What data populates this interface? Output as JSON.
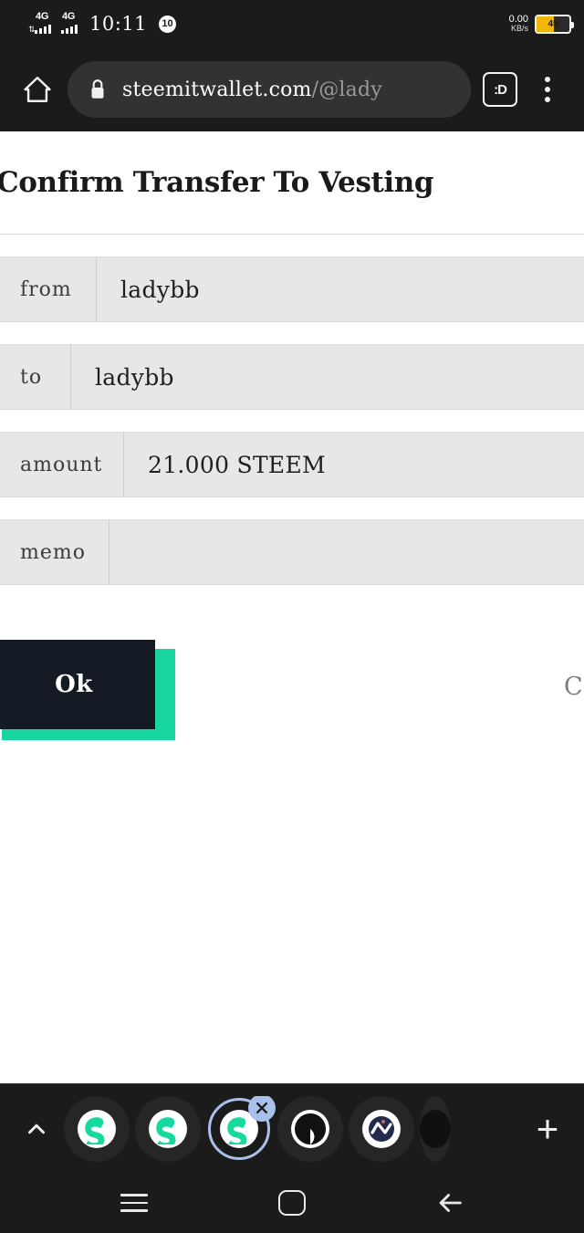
{
  "statusbar": {
    "network_1": "4G",
    "network_2": "4G",
    "time": "10:11",
    "notif_badge": "10",
    "net_speed_value": "0.00",
    "net_speed_unit": "KB/s",
    "battery_level": "45"
  },
  "browser": {
    "home_icon": "home-icon",
    "lock_icon": "lock-icon",
    "url_domain": "steemitwallet.com",
    "url_path": "/@lady",
    "url_full": "steemitwallet.com/@lady",
    "smiley_label": ":D",
    "menu_icon": "overflow-menu-icon"
  },
  "page": {
    "title": "Confirm Transfer To Vesting",
    "rows": [
      {
        "label": "from",
        "value": "ladybb"
      },
      {
        "label": "to",
        "value": "ladybb"
      },
      {
        "label": "amount",
        "value": "21.000 STEEM"
      },
      {
        "label": "memo",
        "value": ""
      }
    ],
    "ok_label": "Ok",
    "cancel_label": "C",
    "accent_teal": "#18d6a0",
    "button_dark": "#141b24",
    "row_bg": "#e7e7e7"
  },
  "tabstrip": {
    "collapse_icon": "chevron-up-icon",
    "new_tab_label": "+",
    "close_label": "✕",
    "tabs": [
      {
        "icon": "steem-icon",
        "active": false
      },
      {
        "icon": "steem-icon",
        "active": false
      },
      {
        "icon": "steem-icon",
        "active": true
      },
      {
        "icon": "globe-icon",
        "active": false
      },
      {
        "icon": "ncase-icon",
        "active": false
      },
      {
        "icon": "partial-tab-icon",
        "active": false
      }
    ]
  },
  "navbar": {
    "recents_icon": "recents-icon",
    "home_icon": "home-pill-icon",
    "back_icon": "back-arrow-icon"
  }
}
